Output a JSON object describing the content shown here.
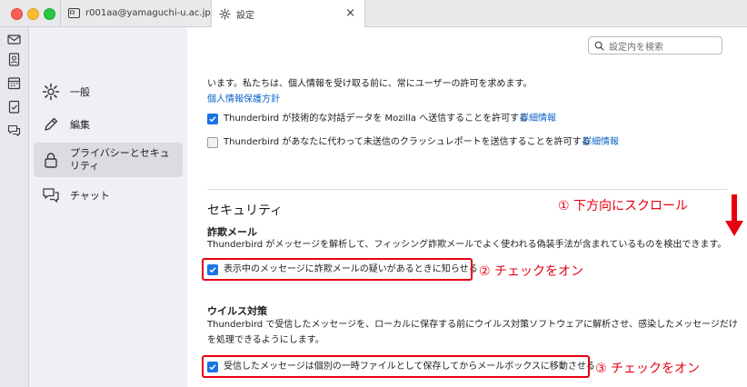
{
  "window": {
    "tabs": [
      {
        "label": "r001aa@yamaguchi-u.ac.jp",
        "icon": "mail-icon"
      },
      {
        "label": "設定",
        "icon": "gear-icon",
        "close": "×"
      }
    ]
  },
  "spaces": [
    "mail-icon",
    "address-book-icon",
    "calendar-icon",
    "tasks-icon",
    "chat-icon"
  ],
  "sidebar": {
    "items": [
      {
        "label": "一般",
        "icon": "gear-icon"
      },
      {
        "label": "編集",
        "icon": "pencil-icon"
      },
      {
        "label": "プライバシーとセキュリティ",
        "icon": "lock-icon",
        "selected": true
      },
      {
        "label": "チャット",
        "icon": "chat-icon"
      }
    ]
  },
  "search": {
    "placeholder": "設定内を検索"
  },
  "privacy": {
    "intro": "います。私たちは、個人情報を受け取る前に、常にユーザーの許可を求めます。",
    "policy_link": "個人情報保護方針",
    "option1": {
      "label": "Thunderbird が技術的な対話データを Mozilla へ送信することを許可する",
      "link": "詳細情報",
      "checked": true
    },
    "option2": {
      "label": "Thunderbird があなたに代わって未送信のクラッシュレポートを送信することを許可する",
      "link": "詳細情報",
      "checked": false
    }
  },
  "security": {
    "heading": "セキュリティ",
    "scam": {
      "title": "詐欺メール",
      "desc": "Thunderbird がメッセージを解析して、フィッシング詐欺メールでよく使われる偽装手法が含まれているものを検出できます。",
      "option": {
        "label": "表示中のメッセージに詐欺メールの疑いがあるときに知らせる",
        "checked": true
      }
    },
    "antivirus": {
      "title": "ウイルス対策",
      "desc_line1": "Thunderbird で受信したメッセージを、ローカルに保存する前にウイルス対策ソフトウェアに解析させ、感染したメッセージだけ",
      "desc_line2": "を処理できるようにします。",
      "option": {
        "label": "受信したメッセージは個別の一時ファイルとして保存してからメールボックスに移動させる",
        "checked": true
      }
    }
  },
  "annotations": {
    "scroll": "① 下方向にスクロール",
    "check2": "② チェックをオン",
    "check3": "③ チェックをオン",
    "color": "#e60012"
  },
  "colors": {
    "accent": "#1a73e8",
    "link": "#0a64c8",
    "annotation": "#e60012"
  }
}
